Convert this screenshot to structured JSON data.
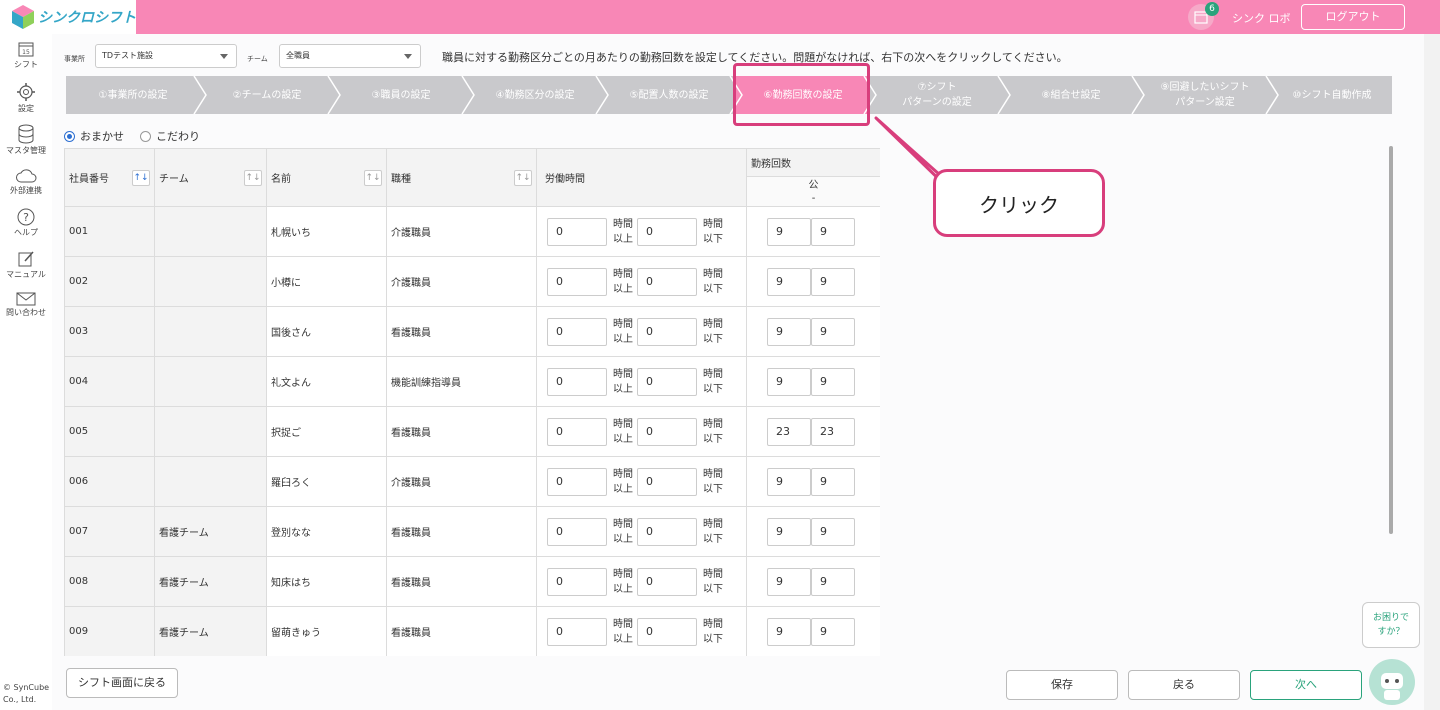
{
  "app": {
    "logo_text": "シンクロシフト",
    "brand_color": "#f887b6",
    "accent": "#2aa37c"
  },
  "header": {
    "calendar_badge": "6",
    "user_name": "シンク ロボ",
    "logout_label": "ログアウト"
  },
  "sidebar": {
    "items": [
      {
        "label": "シフト",
        "icon": "calendar-icon"
      },
      {
        "label": "設定",
        "icon": "gear-icon"
      },
      {
        "label": "マスタ管理",
        "icon": "database-icon"
      },
      {
        "label": "外部連携",
        "icon": "cloud-icon"
      },
      {
        "label": "ヘルプ",
        "icon": "help-icon"
      },
      {
        "label": "マニュアル",
        "icon": "manual-icon"
      },
      {
        "label": "問い合わせ",
        "icon": "mail-icon"
      }
    ],
    "copyright_line1": "© SynCube",
    "copyright_line2": "Co., Ltd."
  },
  "filters": {
    "office_label": "事業所",
    "office_value": "TDテスト施設",
    "team_label": "チーム",
    "team_value": "全職員"
  },
  "instruction": "職員に対する勤務区分ごとの月あたりの勤務回数を設定してください。問題がなければ、右下の次へをクリックしてください。",
  "steps": [
    {
      "label": "①事業所の設定"
    },
    {
      "label": "②チームの設定"
    },
    {
      "label": "③職員の設定"
    },
    {
      "label": "④勤務区分の設定"
    },
    {
      "label": "⑤配置人数の設定"
    },
    {
      "label": "⑥勤務回数の設定"
    },
    {
      "label1": "⑦シフト",
      "label2": "パターンの設定"
    },
    {
      "label": "⑧組合せ設定"
    },
    {
      "label1": "⑨回避したいシフト",
      "label2": "パターン設定"
    },
    {
      "label": "⑩シフト自動作成"
    }
  ],
  "mode": {
    "option1": "おまかせ",
    "option2": "こだわり",
    "selected": "おまかせ"
  },
  "table": {
    "headers": {
      "id": "社員番号",
      "team": "チーム",
      "name": "名前",
      "job": "職種",
      "hours": "労働時間",
      "count": "勤務回数",
      "count_sub": "公",
      "count_sub2": "-"
    },
    "units": {
      "over1": "時間",
      "over2": "以上",
      "under1": "時間",
      "under2": "以下"
    },
    "sort_icon": "↑↓",
    "rows": [
      {
        "id": "001",
        "team": "",
        "name": "札幌いち",
        "job": "介護職員",
        "h_min": "0",
        "h_max": "0",
        "c_min": "9",
        "c_max": "9"
      },
      {
        "id": "002",
        "team": "",
        "name": "小樽に",
        "job": "介護職員",
        "h_min": "0",
        "h_max": "0",
        "c_min": "9",
        "c_max": "9"
      },
      {
        "id": "003",
        "team": "",
        "name": "国後さん",
        "job": "看護職員",
        "h_min": "0",
        "h_max": "0",
        "c_min": "9",
        "c_max": "9"
      },
      {
        "id": "004",
        "team": "",
        "name": "礼文よん",
        "job": "機能訓練指導員",
        "h_min": "0",
        "h_max": "0",
        "c_min": "9",
        "c_max": "9"
      },
      {
        "id": "005",
        "team": "",
        "name": "択捉ご",
        "job": "看護職員",
        "h_min": "0",
        "h_max": "0",
        "c_min": "23",
        "c_max": "23"
      },
      {
        "id": "006",
        "team": "",
        "name": "羅臼ろく",
        "job": "介護職員",
        "h_min": "0",
        "h_max": "0",
        "c_min": "9",
        "c_max": "9"
      },
      {
        "id": "007",
        "team": "看護チーム",
        "name": "登別なな",
        "job": "看護職員",
        "h_min": "0",
        "h_max": "0",
        "c_min": "9",
        "c_max": "9"
      },
      {
        "id": "008",
        "team": "看護チーム",
        "name": "知床はち",
        "job": "看護職員",
        "h_min": "0",
        "h_max": "0",
        "c_min": "9",
        "c_max": "9"
      },
      {
        "id": "009",
        "team": "看護チーム",
        "name": "留萌きゅう",
        "job": "看護職員",
        "h_min": "0",
        "h_max": "0",
        "c_min": "9",
        "c_max": "9"
      }
    ]
  },
  "callout": {
    "text": "クリック"
  },
  "footer": {
    "back_to_shift": "シフト画面に戻る",
    "save": "保存",
    "back": "戻る",
    "next": "次へ"
  },
  "help": {
    "line1": "お困りで",
    "line2": "すか？"
  }
}
